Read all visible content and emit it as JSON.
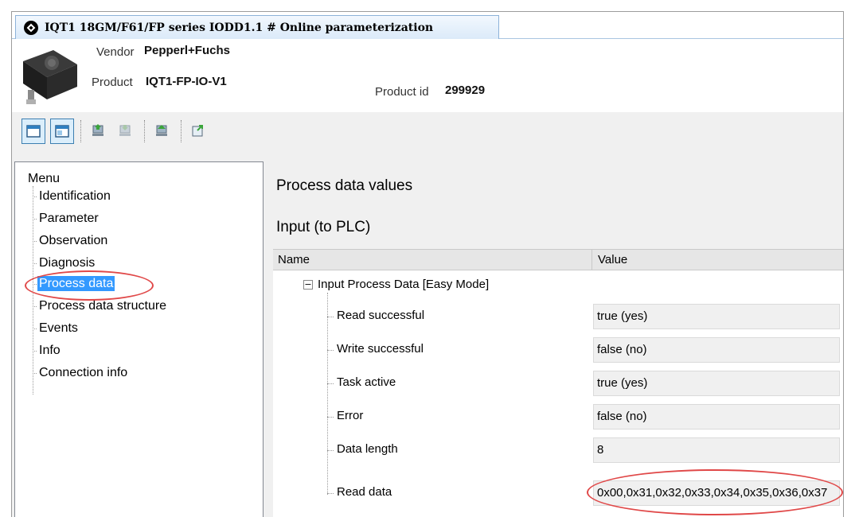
{
  "window": {
    "tab_title": "IQT1 18GM/F61/FP series IODD1.1 # Online parameterization"
  },
  "header": {
    "vendor_label": "Vendor",
    "vendor_value": "Pepperl+Fuchs",
    "product_label": "Product",
    "product_value": "IQT1-FP-IO-V1",
    "product_id_label": "Product id",
    "product_id_value": "299929"
  },
  "toolbar": {
    "icons": [
      "window-icon",
      "window-alt-icon",
      "upload-device-icon",
      "download-device-icon",
      "device-transfer-icon",
      "export-icon"
    ]
  },
  "menu": {
    "root": "Menu",
    "items": [
      {
        "label": "Identification"
      },
      {
        "label": "Parameter"
      },
      {
        "label": "Observation"
      },
      {
        "label": "Diagnosis"
      },
      {
        "label": "Process data",
        "selected": true
      },
      {
        "label": "Process data structure"
      },
      {
        "label": "Events"
      },
      {
        "label": "Info"
      },
      {
        "label": "Connection info"
      }
    ]
  },
  "content": {
    "title": "Process data values",
    "section": "Input (to PLC)",
    "columns": [
      "Name",
      "Value"
    ],
    "group": {
      "label": "Input Process Data [Easy Mode]",
      "expander": "−",
      "rows": [
        {
          "name": "Read successful",
          "value": "true (yes)"
        },
        {
          "name": "Write successful",
          "value": "false (no)"
        },
        {
          "name": "Task active",
          "value": "true (yes)"
        },
        {
          "name": "Error",
          "value": "false (no)"
        },
        {
          "name": "Data length",
          "value": "8"
        },
        {
          "name": "Read data",
          "value": "0x00,0x31,0x32,0x33,0x34,0x35,0x36,0x37"
        }
      ]
    }
  },
  "colors": {
    "selection": "#3399ff",
    "highlight_circle": "#e04848",
    "tab_border": "#8db2d9"
  }
}
